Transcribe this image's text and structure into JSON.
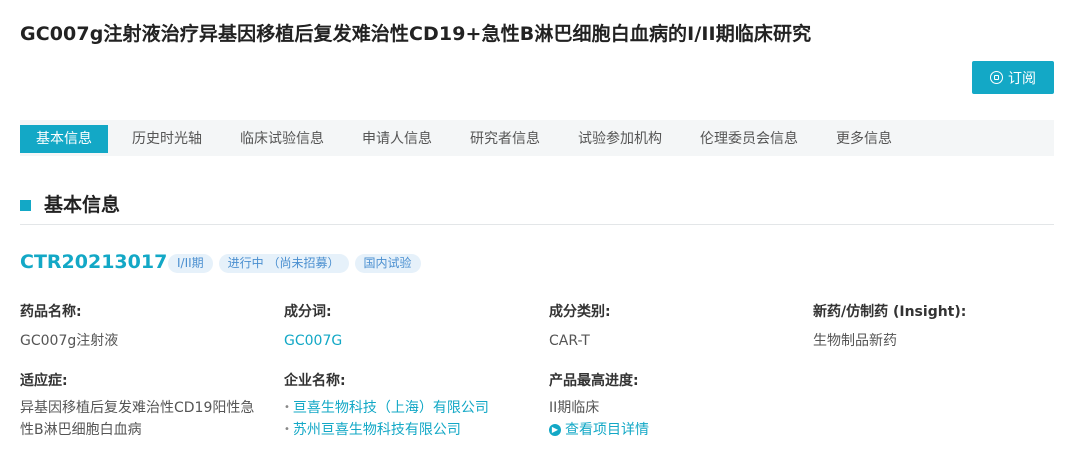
{
  "page": {
    "title": "GC007g注射液治疗异基因移植后复发难治性CD19+急性B淋巴细胞白血病的I/II期临床研究",
    "subscribe_label": "订阅"
  },
  "tabs": [
    {
      "label": "基本信息",
      "active": true
    },
    {
      "label": "历史时光轴"
    },
    {
      "label": "临床试验信息"
    },
    {
      "label": "申请人信息"
    },
    {
      "label": "研究者信息"
    },
    {
      "label": "试验参加机构"
    },
    {
      "label": "伦理委员会信息"
    },
    {
      "label": "更多信息"
    }
  ],
  "section": {
    "title": "基本信息"
  },
  "trial": {
    "id": "CTR20213017",
    "badges": [
      "I/II期",
      "进行中 （尚未招募）",
      "国内试验"
    ]
  },
  "fields": {
    "drug_name": {
      "label": "药品名称:",
      "value": "GC007g注射液"
    },
    "component": {
      "label": "成分词:",
      "value": "GC007G"
    },
    "component_type": {
      "label": "成分类别:",
      "value": "CAR-T"
    },
    "new_drug": {
      "label": "新药/仿制药 (Insight):",
      "value": "生物制品新药"
    },
    "indication": {
      "label": "适应症:",
      "value": "异基因移植后复发难治性CD19阳性急性B淋巴细胞白血病"
    },
    "company": {
      "label": "企业名称:",
      "values": [
        "亘喜生物科技（上海）有限公司",
        "苏州亘喜生物科技有限公司"
      ]
    },
    "highest_stage": {
      "label": "产品最高进度:",
      "value": "II期临床",
      "detail_link": "查看项目详情"
    }
  },
  "colors": {
    "accent": "#13a8c6",
    "badge_bg": "#e6f1fa",
    "badge_text": "#4a8fd0",
    "section_mark_secondary": "#f4c54b"
  }
}
